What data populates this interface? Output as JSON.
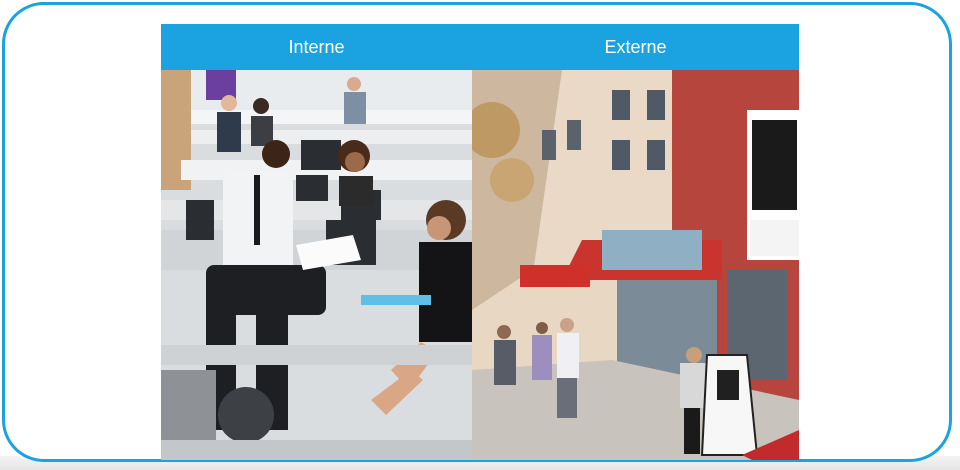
{
  "panels": {
    "left": {
      "header": "Interne",
      "image": "office-interior-photo"
    },
    "right": {
      "header": "Externe",
      "image": "storefront-street-photo"
    }
  },
  "colors": {
    "accent": "#1aa3e0",
    "header_text": "#ffffff"
  }
}
